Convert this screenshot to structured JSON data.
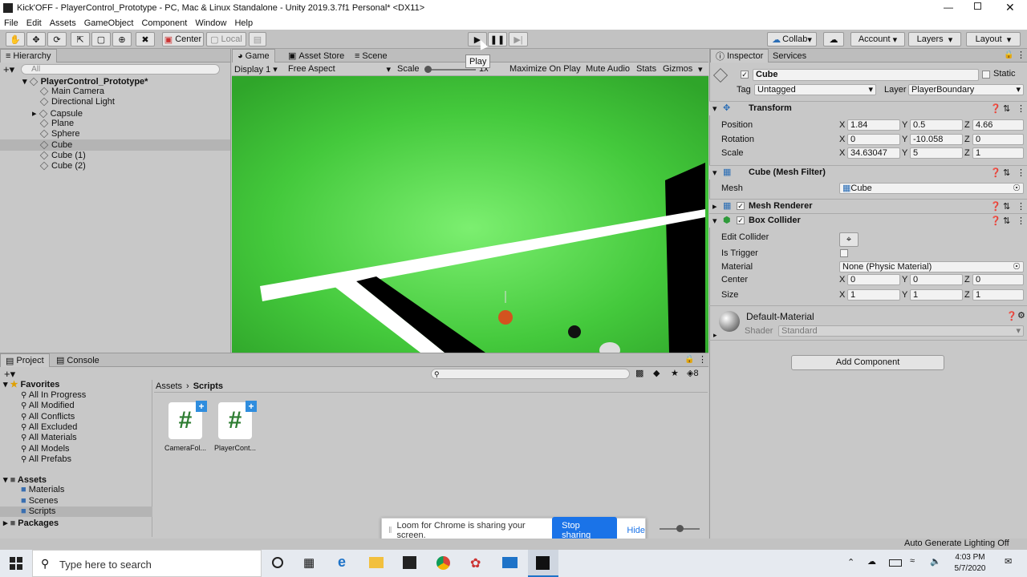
{
  "window": {
    "title": "Kick'OFF - PlayerControl_Prototype - PC, Mac & Linux Standalone - Unity 2019.3.7f1 Personal* <DX11>"
  },
  "menu": [
    "File",
    "Edit",
    "Assets",
    "GameObject",
    "Component",
    "Window",
    "Help"
  ],
  "toolbar": {
    "center": "Center",
    "local": "Local",
    "collab": "Collab",
    "account": "Account",
    "layers": "Layers",
    "layout": "Layout",
    "play_tooltip": "Play"
  },
  "hierarchy": {
    "tab": "Hierarchy",
    "search_placeholder": "All",
    "scene": "PlayerControl_Prototype*",
    "items": [
      "Main Camera",
      "Directional Light",
      "Capsule",
      "Plane",
      "Sphere",
      "Cube",
      "Cube (1)",
      "Cube (2)"
    ]
  },
  "game": {
    "tabs": [
      "Game",
      "Asset Store",
      "Scene"
    ],
    "display": "Display 1",
    "aspect": "Free Aspect",
    "scale_label": "Scale",
    "scale_value": "1x",
    "maximize": "Maximize On Play",
    "mute": "Mute Audio",
    "stats": "Stats",
    "gizmos": "Gizmos"
  },
  "inspector": {
    "tabs": [
      "Inspector",
      "Services"
    ],
    "name": "Cube",
    "static": "Static",
    "tag_label": "Tag",
    "tag": "Untagged",
    "layer_label": "Layer",
    "layer": "PlayerBoundary",
    "transform": {
      "title": "Transform",
      "position_label": "Position",
      "rotation_label": "Rotation",
      "scale_label": "Scale",
      "position": [
        "1.84",
        "0.5",
        "4.66"
      ],
      "rotation": [
        "0",
        "-10.058",
        "0"
      ],
      "scale": [
        "34.63047",
        "5",
        "1"
      ]
    },
    "mesh_filter": {
      "title": "Cube (Mesh Filter)",
      "mesh_label": "Mesh",
      "mesh": "Cube"
    },
    "mesh_renderer": {
      "title": "Mesh Renderer"
    },
    "box_collider": {
      "title": "Box Collider",
      "edit_label": "Edit Collider",
      "trigger_label": "Is Trigger",
      "material_label": "Material",
      "material": "None (Physic Material)",
      "center_label": "Center",
      "center": [
        "0",
        "0",
        "0"
      ],
      "size_label": "Size",
      "size": [
        "1",
        "1",
        "1"
      ]
    },
    "material": {
      "name": "Default-Material",
      "shader_label": "Shader",
      "shader": "Standard"
    },
    "add_component": "Add Component",
    "axes": [
      "X",
      "Y",
      "Z"
    ]
  },
  "project": {
    "tabs": [
      "Project",
      "Console"
    ],
    "favorites_title": "Favorites",
    "favorites": [
      "All In Progress",
      "All Modified",
      "All Conflicts",
      "All Excluded",
      "All Materials",
      "All Models",
      "All Prefabs"
    ],
    "assets_title": "Assets",
    "asset_folders": [
      "Materials",
      "Scenes",
      "Scripts"
    ],
    "packages": "Packages",
    "breadcrumb_root": "Assets",
    "breadcrumb_current": "Scripts",
    "files": [
      "CameraFol...",
      "PlayerCont..."
    ],
    "count": "8"
  },
  "share": {
    "message": "Loom for Chrome is sharing your screen.",
    "stop": "Stop sharing",
    "hide": "Hide"
  },
  "status": {
    "lighting": "Auto Generate Lighting Off"
  },
  "taskbar": {
    "search": "Type here to search",
    "time": "4:03 PM",
    "date": "5/7/2020"
  },
  "colors": {
    "game_bg": "#3cc33c",
    "accent": "#1a73e8"
  }
}
